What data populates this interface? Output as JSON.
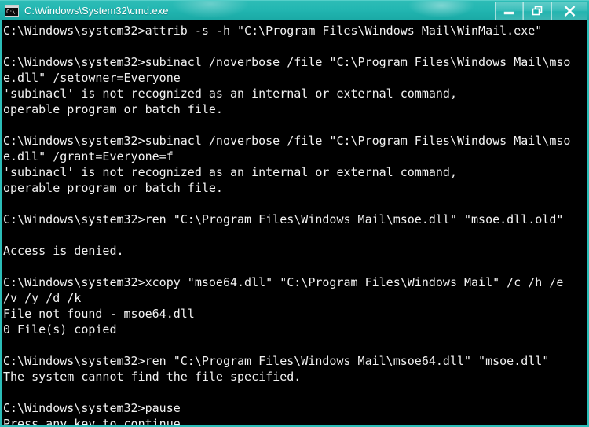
{
  "window": {
    "title": "C:\\Windows\\System32\\cmd.exe",
    "icon": "cmd-console-icon",
    "icon_glyph": "C:\\.",
    "accent_color": "#23b7b2",
    "terminal_background": "#000000",
    "terminal_foreground": "#f2f2f2",
    "controls": [
      {
        "name": "minimize",
        "label": "Minimize"
      },
      {
        "name": "restore",
        "label": "Restore Down"
      },
      {
        "name": "close",
        "label": "Close"
      }
    ]
  },
  "terminal": {
    "prompt": "C:\\Windows\\system32>",
    "lines": [
      "C:\\Windows\\system32>attrib -s -h \"C:\\Program Files\\Windows Mail\\WinMail.exe\"",
      "",
      "C:\\Windows\\system32>subinacl /noverbose /file \"C:\\Program Files\\Windows Mail\\mso",
      "e.dll\" /setowner=Everyone",
      "'subinacl' is not recognized as an internal or external command,",
      "operable program or batch file.",
      "",
      "C:\\Windows\\system32>subinacl /noverbose /file \"C:\\Program Files\\Windows Mail\\mso",
      "e.dll\" /grant=Everyone=f",
      "'subinacl' is not recognized as an internal or external command,",
      "operable program or batch file.",
      "",
      "C:\\Windows\\system32>ren \"C:\\Program Files\\Windows Mail\\msoe.dll\" \"msoe.dll.old\"",
      "",
      "Access is denied.",
      "",
      "C:\\Windows\\system32>xcopy \"msoe64.dll\" \"C:\\Program Files\\Windows Mail\" /c /h /e",
      "/v /y /d /k",
      "File not found - msoe64.dll",
      "0 File(s) copied",
      "",
      "C:\\Windows\\system32>ren \"C:\\Program Files\\Windows Mail\\msoe64.dll\" \"msoe.dll\"",
      "The system cannot find the file specified.",
      "",
      "C:\\Windows\\system32>pause",
      "Press any key to continue . . ."
    ]
  }
}
